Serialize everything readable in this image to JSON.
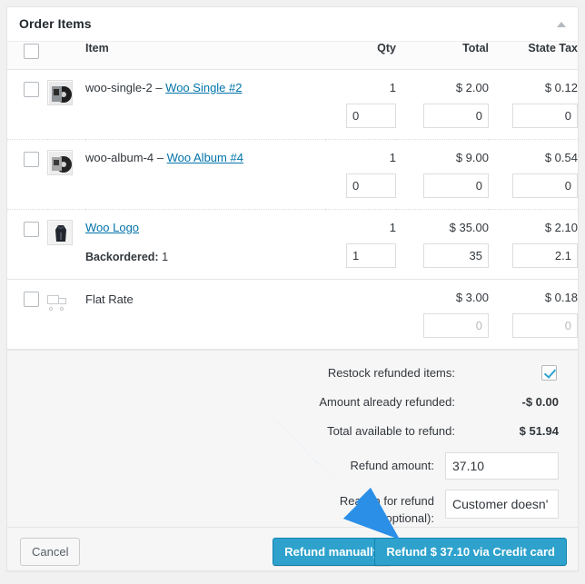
{
  "panel": {
    "title": "Order Items",
    "toggle_icon": "collapse-triangle-up-icon"
  },
  "table": {
    "headers": {
      "select_all": "",
      "item": "Item",
      "qty": "Qty",
      "total": "Total",
      "tax": "State Tax"
    },
    "rows": [
      {
        "type": "product",
        "sku": "woo-single-2",
        "separator": " – ",
        "name": "Woo Single #2",
        "qty": "1",
        "total": "$ 2.00",
        "tax": "$ 0.12",
        "qty_refund": "0",
        "total_refund": "0",
        "tax_refund": "0",
        "meta_label": "",
        "meta_value": "",
        "thumb": "vinyl-record-thumbnail"
      },
      {
        "type": "product",
        "sku": "woo-album-4",
        "separator": " – ",
        "name": "Woo Album #4",
        "qty": "1",
        "total": "$ 9.00",
        "tax": "$ 0.54",
        "qty_refund": "0",
        "total_refund": "0",
        "tax_refund": "0",
        "meta_label": "",
        "meta_value": "",
        "thumb": "vinyl-album-thumbnail"
      },
      {
        "type": "product",
        "sku": "",
        "separator": "",
        "name": "Woo Logo",
        "qty": "1",
        "total": "$ 35.00",
        "tax": "$ 2.10",
        "qty_refund": "1",
        "total_refund": "35",
        "tax_refund": "2.1",
        "meta_label": "Backordered:",
        "meta_value": "1",
        "thumb": "hoodie-thumbnail"
      }
    ],
    "shipping": {
      "type": "shipping",
      "name": "Flat Rate",
      "total": "$ 3.00",
      "tax": "$ 0.18",
      "total_refund_placeholder": "0",
      "tax_refund_placeholder": "0",
      "icon": "shipping-truck-icon"
    }
  },
  "refund": {
    "restock_label": "Restock refunded items:",
    "restock_checked": true,
    "already_refunded_label": "Amount already refunded:",
    "already_refunded_value": "-$ 0.00",
    "available_label": "Total available to refund:",
    "available_value": "$ 51.94",
    "amount_label": "Refund amount:",
    "amount_value": "37.10",
    "reason_label_line1": "Reason for refund",
    "reason_label_line2": "(optional):",
    "reason_value": "Customer doesn'"
  },
  "footer": {
    "cancel_label": "Cancel",
    "manual_label": "Refund manually",
    "refund_label": "Refund $ 37.10 via Credit card"
  },
  "annotation": {
    "arrow_color": "#2b8fe8",
    "arrow_name": "blue-pointer-arrow"
  },
  "colors": {
    "accent": "#2ea2cc",
    "link": "#0073aa",
    "text": "#32373c",
    "panel_bg": "#ffffff",
    "refund_bg": "#f6f6f6"
  }
}
